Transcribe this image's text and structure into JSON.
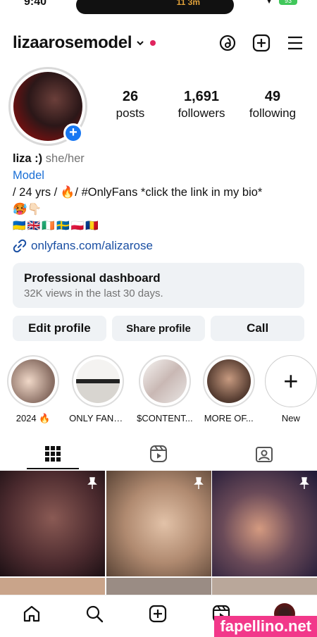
{
  "status": {
    "time": "9:40",
    "island_text": "11 3m",
    "battery": "93"
  },
  "header": {
    "username": "lizaarosemodel"
  },
  "stats": [
    {
      "num": "26",
      "label": "posts"
    },
    {
      "num": "1,691",
      "label": "followers"
    },
    {
      "num": "49",
      "label": "following"
    }
  ],
  "bio": {
    "name": "liza :)",
    "pronouns": "she/her",
    "category": "Model",
    "line1": "/ 24 yrs / 🔥/ #OnlyFans *click the link in my bio*",
    "line2": "🥵👇🏻",
    "flags": "🇺🇦🇬🇧🇮🇪🇸🇪🇵🇱🇷🇴",
    "link": "onlyfans.com/alizarose"
  },
  "dashboard": {
    "title": "Professional dashboard",
    "subtitle": "32K views in the last 30 days."
  },
  "buttons": {
    "edit": "Edit profile",
    "share": "Share profile",
    "call": "Call"
  },
  "highlights": [
    {
      "label": "2024 🔥",
      "color": "#8a6f64"
    },
    {
      "label": "ONLY FANS :)",
      "color": "#d8d5d0"
    },
    {
      "label": "$CONTENT...",
      "color": "#e9e6e4"
    },
    {
      "label": "MORE OF...",
      "color": "#5a4034"
    }
  ],
  "highlight_new": {
    "label": "New"
  },
  "grid_colors": [
    "#4b2a2e",
    "#b08a70",
    "#3e2a4a",
    "#c9a48a",
    "#9a8c84",
    "#b9a79a"
  ],
  "watermark": "fapellino.net"
}
